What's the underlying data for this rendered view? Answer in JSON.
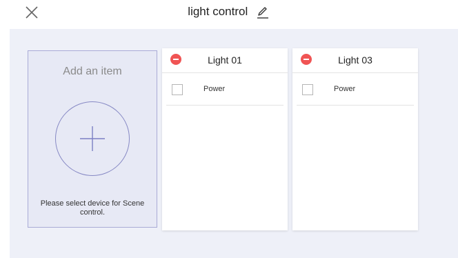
{
  "header": {
    "title": "light control",
    "close_icon": "close-icon",
    "edit_icon": "pencil-icon"
  },
  "add_item": {
    "title": "Add an item",
    "hint": "Please select device for Scene control.",
    "icon": "plus-icon"
  },
  "devices": [
    {
      "name": "Light 01",
      "rows": [
        {
          "label": "Power",
          "checked": false
        }
      ]
    },
    {
      "name": "Light 03",
      "rows": [
        {
          "label": "Power",
          "checked": false
        }
      ]
    }
  ],
  "colors": {
    "accent": "#7b7fc4",
    "remove": "#f05454",
    "background": "#eef0f8"
  }
}
